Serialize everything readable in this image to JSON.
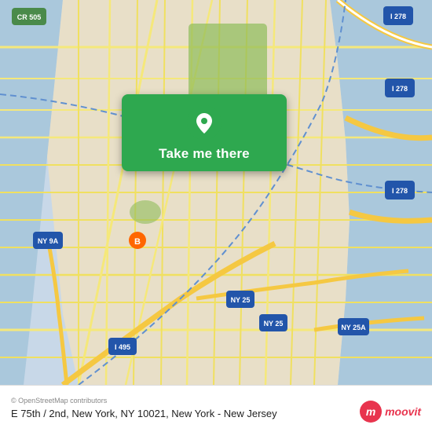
{
  "map": {
    "background_color": "#e8e0d0",
    "attribution": "© OpenStreetMap contributors"
  },
  "card": {
    "button_label": "Take me there",
    "background_color": "#2ea84f"
  },
  "bottom_bar": {
    "location_text": "E 75th / 2nd, New York, NY 10021, New York - New Jersey",
    "attribution": "© OpenStreetMap contributors"
  },
  "moovit": {
    "logo_text": "moovit",
    "logo_letter": "m"
  },
  "route_labels": {
    "cr505": "CR 505",
    "i278_top": "I 278",
    "i278_mid": "I 278",
    "i278_right": "I 278",
    "ny9a": "NY 9A",
    "ny25_1": "NY 25",
    "ny25_2": "NY 25",
    "ny25a": "NY 25A",
    "i495": "I 495",
    "b": "B"
  }
}
